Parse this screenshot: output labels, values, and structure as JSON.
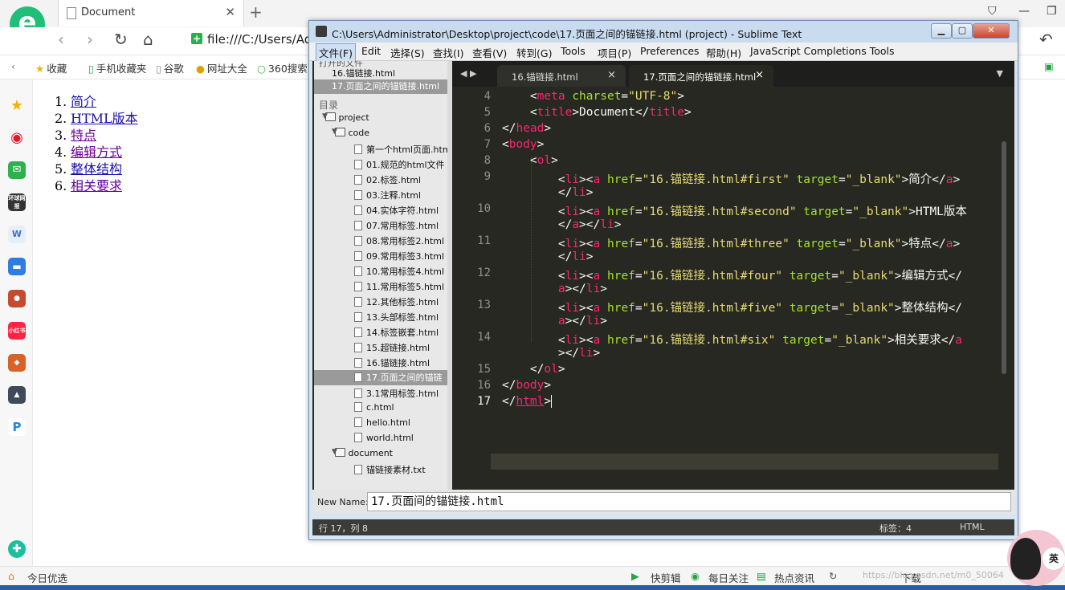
{
  "browser": {
    "tab_title": "Document",
    "url": "file:///C:/Users/Adn",
    "bookmarks": [
      "收藏",
      "手机收藏夹",
      "谷歌",
      "网址大全",
      "360搜索"
    ],
    "sidebar_icons": [
      "star-icon",
      "weibo-icon",
      "mail-icon",
      "news-icon",
      "docs-icon",
      "chat-icon",
      "game-icon",
      "xiaohongshu-icon",
      "game2-icon",
      "game3-icon",
      "p-icon"
    ],
    "sidebar_labels": {
      "news": "环球网报",
      "xhs": "小红书"
    }
  },
  "page": {
    "links": [
      {
        "num": "1.",
        "text": "简介",
        "visited": false
      },
      {
        "num": "2.",
        "text": "HTML版本",
        "visited": false
      },
      {
        "num": "3.",
        "text": "特点",
        "visited": true
      },
      {
        "num": "4.",
        "text": "编辑方式",
        "visited": true
      },
      {
        "num": "5.",
        "text": "整体结构",
        "visited": false
      },
      {
        "num": "6.",
        "text": "相关要求",
        "visited": true
      }
    ]
  },
  "statusbar": {
    "left": "今日优选",
    "items": [
      "快剪辑",
      "每日关注",
      "热点资讯",
      "下载"
    ],
    "watermark": "https://blog.csdn.net/m0_50064"
  },
  "sublime": {
    "title": "C:\\Users\\Administrator\\Desktop\\project\\code\\17.页面之间的锚链接.html (project) - Sublime Text",
    "menu": [
      "文件(F)",
      "Edit",
      "选择(S)",
      "查找(I)",
      "查看(V)",
      "转到(G)",
      "Tools",
      "项目(P)",
      "Preferences",
      "帮助(H)",
      "JavaScript Completions Tools"
    ],
    "sidebar": {
      "open_files_header": "打开的文件",
      "open_files": [
        "16.锚链接.html",
        "17.页面之间的锚链接.html"
      ],
      "folders_header": "目录",
      "project": "project",
      "code_folder": "code",
      "code_files": [
        "第一个html页面.html",
        "01.规范的html文件",
        "02.标签.html",
        "03.注释.html",
        "04.实体字符.html",
        "07.常用标签.html",
        "08.常用标签2.html",
        "09.常用标签3.html",
        "10.常用标签4.html",
        "11.常用标签5.html",
        "12.其他标签.html",
        "13.头部标签.html",
        "14.标签嵌套.html",
        "15.超链接.html",
        "16.锚链接.html",
        "17.页面之间的锚链",
        "3.1常用标签.html",
        "c.html",
        "hello.html",
        "world.html"
      ],
      "document_folder": "document",
      "document_files": [
        "锚链接素材.txt"
      ]
    },
    "tabs": [
      "16.锚链接.html",
      "17.页面之间的锚链接.html"
    ],
    "line_numbers": [
      "4",
      "5",
      "6",
      "7",
      "8",
      "9",
      "",
      "10",
      "",
      "11",
      "",
      "12",
      "",
      "13",
      "",
      "14",
      "",
      "15",
      "16",
      "17"
    ],
    "new_name_label": "New Name:",
    "new_name_value": "17.页面间的锚链接.html",
    "status_left": "行 17，列 8",
    "status_tab": "标签：4",
    "status_syntax": "HTML"
  }
}
